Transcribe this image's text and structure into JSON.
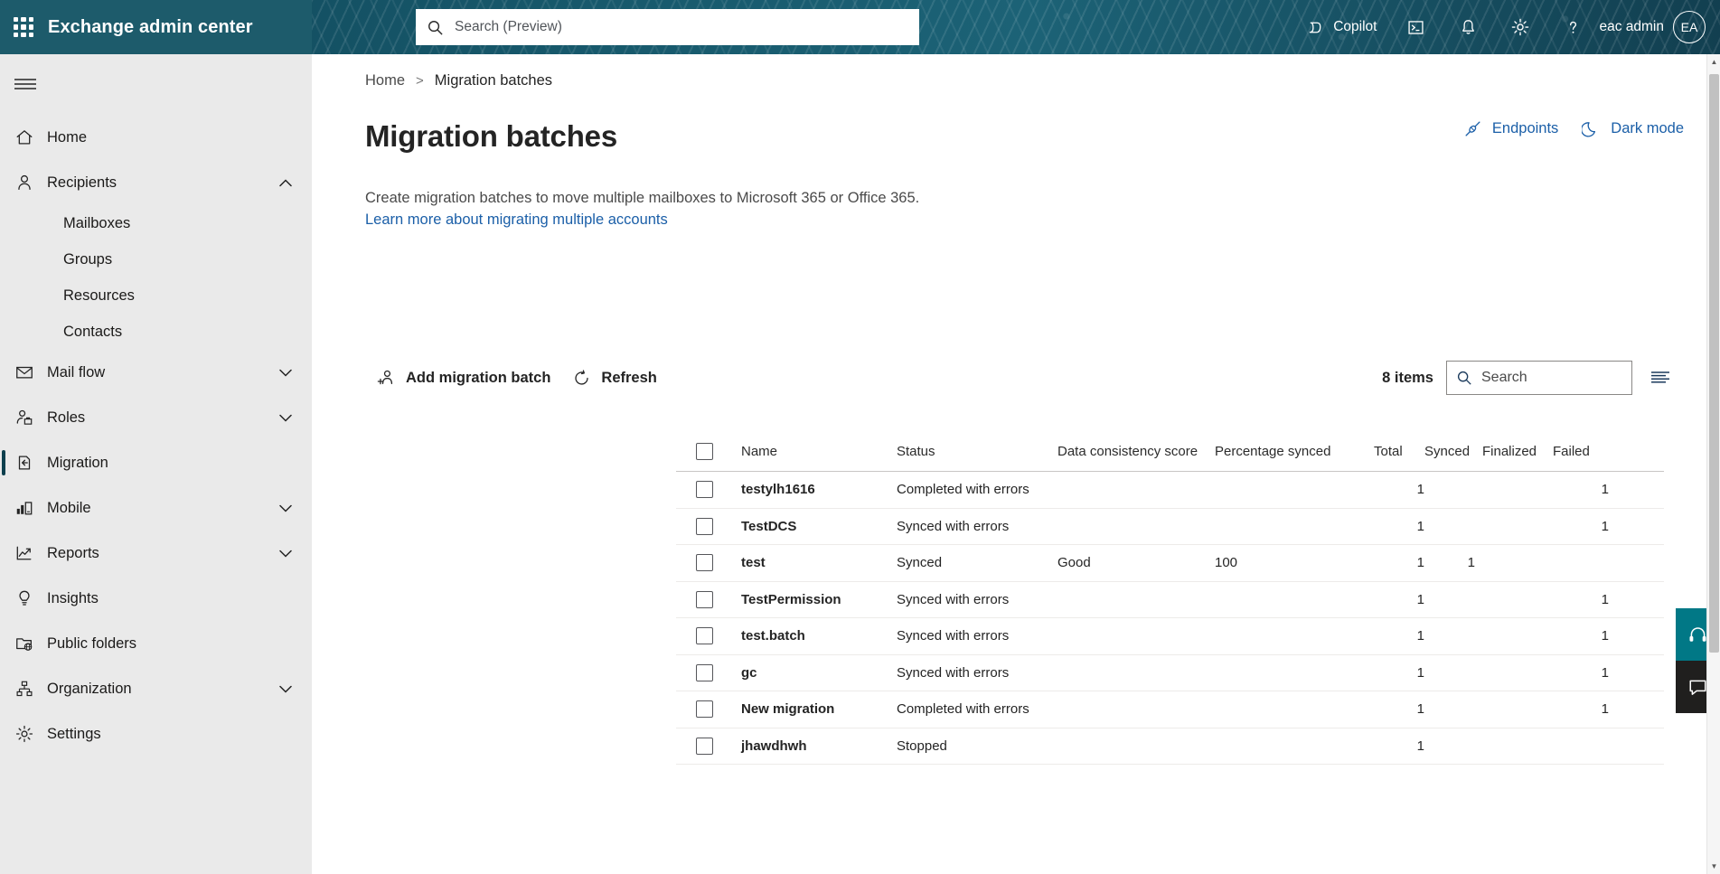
{
  "header": {
    "brand_title": "Exchange admin center",
    "waffle_name": "app-launcher",
    "search_placeholder": "Search (Preview)",
    "copilot_label": "Copilot",
    "user_name": "eac admin",
    "avatar_initials": "EA",
    "background_color": "#0d3f4d",
    "icons": [
      "terminal-icon",
      "bell-icon",
      "gear-icon",
      "help-icon"
    ]
  },
  "sidebar": {
    "hamburger_name": "nav-toggle",
    "items": [
      {
        "label": "Home",
        "icon": "home-icon",
        "chevron": false,
        "selected": false
      },
      {
        "label": "Recipients",
        "icon": "person-icon",
        "chevron": true,
        "expanded": true,
        "selected": false
      },
      {
        "label": "Mail flow",
        "icon": "mail-icon",
        "chevron": true,
        "selected": false
      },
      {
        "label": "Roles",
        "icon": "person-briefcase-icon",
        "chevron": true,
        "selected": false
      },
      {
        "label": "Migration",
        "icon": "migration-icon",
        "chevron": false,
        "selected": true
      },
      {
        "label": "Mobile",
        "icon": "mobile-icon",
        "chevron": true,
        "selected": false
      },
      {
        "label": "Reports",
        "icon": "reports-chart-icon",
        "chevron": true,
        "selected": false
      },
      {
        "label": "Insights",
        "icon": "lightbulb-icon",
        "chevron": false,
        "selected": false
      },
      {
        "label": "Public folders",
        "icon": "public-folder-icon",
        "chevron": false,
        "selected": false
      },
      {
        "label": "Organization",
        "icon": "organization-icon",
        "chevron": true,
        "selected": false
      },
      {
        "label": "Settings",
        "icon": "settings-gear-icon",
        "chevron": false,
        "selected": false
      }
    ],
    "recipients_children": [
      "Mailboxes",
      "Groups",
      "Resources",
      "Contacts"
    ]
  },
  "breadcrumb": {
    "home": "Home",
    "separator": ">",
    "current": "Migration batches"
  },
  "page_actions": {
    "endpoints_label": "Endpoints",
    "endpoints_icon": "plug-icon",
    "dark_mode_label": "Dark mode",
    "dark_mode_icon": "moon-icon",
    "link_color": "#1b5fa8"
  },
  "page": {
    "title": "Migration batches",
    "description": "Create migration batches to move multiple mailboxes to Microsoft 365 or Office 365.",
    "learn_more_link": "Learn more about migrating multiple accounts"
  },
  "commandbar": {
    "add_label": "Add migration batch",
    "add_icon": "add-person-icon",
    "refresh_label": "Refresh",
    "refresh_icon": "refresh-icon",
    "items_count": "8 items",
    "search_placeholder": "Search",
    "search_icon": "search-icon",
    "view_options_icon": "list-view-icon"
  },
  "table": {
    "columns": [
      "Name",
      "Status",
      "Data consistency score",
      "Percentage synced",
      "Total",
      "Synced",
      "Finalized",
      "Failed"
    ],
    "rows": [
      {
        "name": "testylh1616",
        "status": "Completed with errors",
        "dcs": "",
        "pct": "",
        "total": "1",
        "synced": "",
        "finalized": "",
        "failed": "1"
      },
      {
        "name": "TestDCS",
        "status": "Synced with errors",
        "dcs": "",
        "pct": "",
        "total": "1",
        "synced": "",
        "finalized": "",
        "failed": "1"
      },
      {
        "name": "test",
        "status": "Synced",
        "dcs": "Good",
        "pct": "100",
        "total": "1",
        "synced": "1",
        "finalized": "",
        "failed": ""
      },
      {
        "name": "TestPermission",
        "status": "Synced with errors",
        "dcs": "",
        "pct": "",
        "total": "1",
        "synced": "",
        "finalized": "",
        "failed": "1"
      },
      {
        "name": "test.batch",
        "status": "Synced with errors",
        "dcs": "",
        "pct": "",
        "total": "1",
        "synced": "",
        "finalized": "",
        "failed": "1"
      },
      {
        "name": "gc",
        "status": "Synced with errors",
        "dcs": "",
        "pct": "",
        "total": "1",
        "synced": "",
        "finalized": "",
        "failed": "1"
      },
      {
        "name": "New migration",
        "status": "Completed with errors",
        "dcs": "",
        "pct": "",
        "total": "1",
        "synced": "",
        "finalized": "",
        "failed": "1"
      },
      {
        "name": "jhawdhwh",
        "status": "Stopped",
        "dcs": "",
        "pct": "",
        "total": "1",
        "synced": "",
        "finalized": "",
        "failed": ""
      }
    ]
  },
  "float_buttons": {
    "help_icon": "headset-icon",
    "help_color": "#017886",
    "feedback_icon": "feedback-chat-icon",
    "feedback_color": "#201f1e"
  }
}
